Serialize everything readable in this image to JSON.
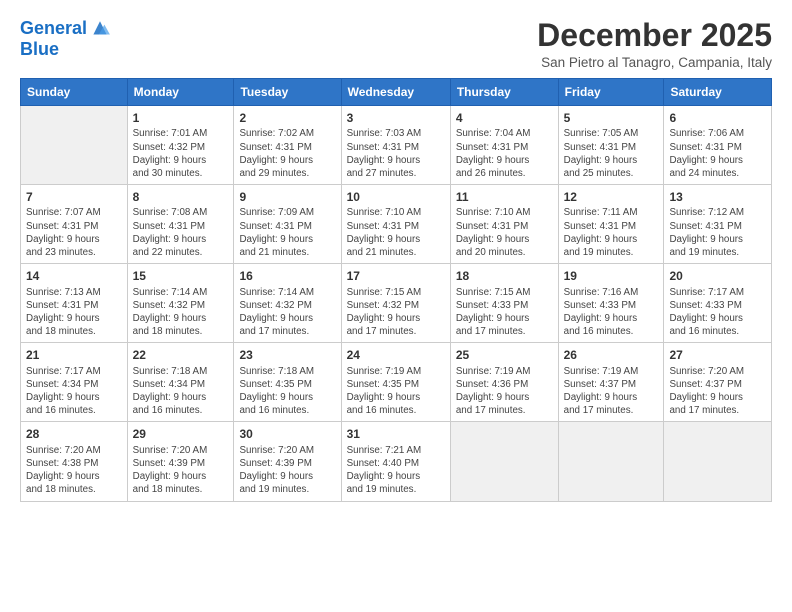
{
  "header": {
    "logo_line1": "General",
    "logo_line2": "Blue",
    "month_title": "December 2025",
    "subtitle": "San Pietro al Tanagro, Campania, Italy"
  },
  "days_of_week": [
    "Sunday",
    "Monday",
    "Tuesday",
    "Wednesday",
    "Thursday",
    "Friday",
    "Saturday"
  ],
  "weeks": [
    [
      {
        "day": "",
        "info": ""
      },
      {
        "day": "1",
        "info": "Sunrise: 7:01 AM\nSunset: 4:32 PM\nDaylight: 9 hours\nand 30 minutes."
      },
      {
        "day": "2",
        "info": "Sunrise: 7:02 AM\nSunset: 4:31 PM\nDaylight: 9 hours\nand 29 minutes."
      },
      {
        "day": "3",
        "info": "Sunrise: 7:03 AM\nSunset: 4:31 PM\nDaylight: 9 hours\nand 27 minutes."
      },
      {
        "day": "4",
        "info": "Sunrise: 7:04 AM\nSunset: 4:31 PM\nDaylight: 9 hours\nand 26 minutes."
      },
      {
        "day": "5",
        "info": "Sunrise: 7:05 AM\nSunset: 4:31 PM\nDaylight: 9 hours\nand 25 minutes."
      },
      {
        "day": "6",
        "info": "Sunrise: 7:06 AM\nSunset: 4:31 PM\nDaylight: 9 hours\nand 24 minutes."
      }
    ],
    [
      {
        "day": "7",
        "info": "Sunrise: 7:07 AM\nSunset: 4:31 PM\nDaylight: 9 hours\nand 23 minutes."
      },
      {
        "day": "8",
        "info": "Sunrise: 7:08 AM\nSunset: 4:31 PM\nDaylight: 9 hours\nand 22 minutes."
      },
      {
        "day": "9",
        "info": "Sunrise: 7:09 AM\nSunset: 4:31 PM\nDaylight: 9 hours\nand 21 minutes."
      },
      {
        "day": "10",
        "info": "Sunrise: 7:10 AM\nSunset: 4:31 PM\nDaylight: 9 hours\nand 21 minutes."
      },
      {
        "day": "11",
        "info": "Sunrise: 7:10 AM\nSunset: 4:31 PM\nDaylight: 9 hours\nand 20 minutes."
      },
      {
        "day": "12",
        "info": "Sunrise: 7:11 AM\nSunset: 4:31 PM\nDaylight: 9 hours\nand 19 minutes."
      },
      {
        "day": "13",
        "info": "Sunrise: 7:12 AM\nSunset: 4:31 PM\nDaylight: 9 hours\nand 19 minutes."
      }
    ],
    [
      {
        "day": "14",
        "info": "Sunrise: 7:13 AM\nSunset: 4:31 PM\nDaylight: 9 hours\nand 18 minutes."
      },
      {
        "day": "15",
        "info": "Sunrise: 7:14 AM\nSunset: 4:32 PM\nDaylight: 9 hours\nand 18 minutes."
      },
      {
        "day": "16",
        "info": "Sunrise: 7:14 AM\nSunset: 4:32 PM\nDaylight: 9 hours\nand 17 minutes."
      },
      {
        "day": "17",
        "info": "Sunrise: 7:15 AM\nSunset: 4:32 PM\nDaylight: 9 hours\nand 17 minutes."
      },
      {
        "day": "18",
        "info": "Sunrise: 7:15 AM\nSunset: 4:33 PM\nDaylight: 9 hours\nand 17 minutes."
      },
      {
        "day": "19",
        "info": "Sunrise: 7:16 AM\nSunset: 4:33 PM\nDaylight: 9 hours\nand 16 minutes."
      },
      {
        "day": "20",
        "info": "Sunrise: 7:17 AM\nSunset: 4:33 PM\nDaylight: 9 hours\nand 16 minutes."
      }
    ],
    [
      {
        "day": "21",
        "info": "Sunrise: 7:17 AM\nSunset: 4:34 PM\nDaylight: 9 hours\nand 16 minutes."
      },
      {
        "day": "22",
        "info": "Sunrise: 7:18 AM\nSunset: 4:34 PM\nDaylight: 9 hours\nand 16 minutes."
      },
      {
        "day": "23",
        "info": "Sunrise: 7:18 AM\nSunset: 4:35 PM\nDaylight: 9 hours\nand 16 minutes."
      },
      {
        "day": "24",
        "info": "Sunrise: 7:19 AM\nSunset: 4:35 PM\nDaylight: 9 hours\nand 16 minutes."
      },
      {
        "day": "25",
        "info": "Sunrise: 7:19 AM\nSunset: 4:36 PM\nDaylight: 9 hours\nand 17 minutes."
      },
      {
        "day": "26",
        "info": "Sunrise: 7:19 AM\nSunset: 4:37 PM\nDaylight: 9 hours\nand 17 minutes."
      },
      {
        "day": "27",
        "info": "Sunrise: 7:20 AM\nSunset: 4:37 PM\nDaylight: 9 hours\nand 17 minutes."
      }
    ],
    [
      {
        "day": "28",
        "info": "Sunrise: 7:20 AM\nSunset: 4:38 PM\nDaylight: 9 hours\nand 18 minutes."
      },
      {
        "day": "29",
        "info": "Sunrise: 7:20 AM\nSunset: 4:39 PM\nDaylight: 9 hours\nand 18 minutes."
      },
      {
        "day": "30",
        "info": "Sunrise: 7:20 AM\nSunset: 4:39 PM\nDaylight: 9 hours\nand 19 minutes."
      },
      {
        "day": "31",
        "info": "Sunrise: 7:21 AM\nSunset: 4:40 PM\nDaylight: 9 hours\nand 19 minutes."
      },
      {
        "day": "",
        "info": ""
      },
      {
        "day": "",
        "info": ""
      },
      {
        "day": "",
        "info": ""
      }
    ]
  ]
}
